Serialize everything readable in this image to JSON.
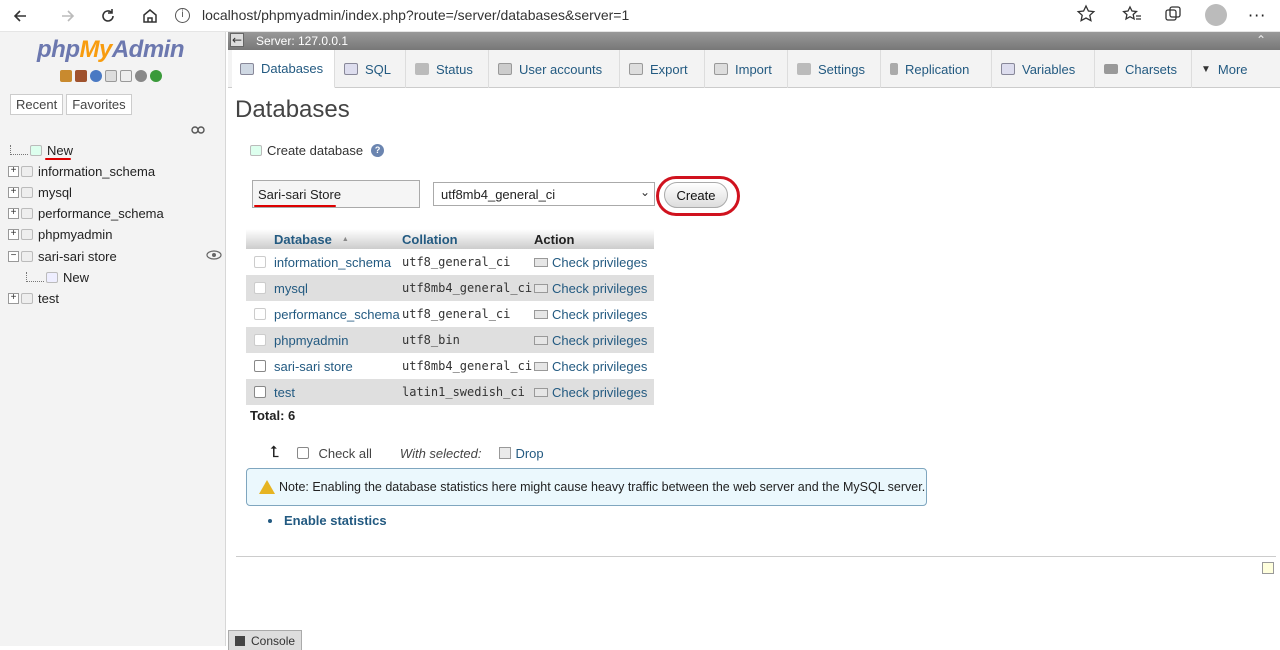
{
  "browser": {
    "url": "localhost/phpmyadmin/index.php?route=/server/databases&server=1"
  },
  "sidebar": {
    "logo": {
      "php": "php",
      "my": "My",
      "admin": "Admin"
    },
    "tabs": [
      "Recent",
      "Favorites"
    ],
    "tree": [
      {
        "label": "New",
        "type": "new"
      },
      {
        "label": "information_schema",
        "type": "db"
      },
      {
        "label": "mysql",
        "type": "db"
      },
      {
        "label": "performance_schema",
        "type": "db"
      },
      {
        "label": "phpmyadmin",
        "type": "db"
      },
      {
        "label": "sari-sari store",
        "type": "db-open"
      },
      {
        "label": "New",
        "type": "new-child"
      },
      {
        "label": "test",
        "type": "db"
      }
    ]
  },
  "server_bar": {
    "label": "Server: 127.0.0.1"
  },
  "menu": [
    {
      "label": "Databases",
      "icon": "database-icon"
    },
    {
      "label": "SQL",
      "icon": "sql-icon"
    },
    {
      "label": "Status",
      "icon": "status-icon"
    },
    {
      "label": "User accounts",
      "icon": "users-icon"
    },
    {
      "label": "Export",
      "icon": "export-icon"
    },
    {
      "label": "Import",
      "icon": "import-icon"
    },
    {
      "label": "Settings",
      "icon": "wrench-icon"
    },
    {
      "label": "Replication",
      "icon": "replication-icon"
    },
    {
      "label": "Variables",
      "icon": "variables-icon"
    },
    {
      "label": "Charsets",
      "icon": "charsets-icon"
    },
    {
      "label": "More",
      "icon": "chevron-down-icon"
    }
  ],
  "page": {
    "title": "Databases",
    "create_label": "Create database",
    "db_name_value": "Sari-sari Store",
    "collation_value": "utf8mb4_general_ci",
    "create_button": "Create"
  },
  "table": {
    "headers": {
      "database": "Database",
      "collation": "Collation",
      "action": "Action"
    },
    "sort_indicator": "▲",
    "rows": [
      {
        "name": "information_schema",
        "collation": "utf8_general_ci",
        "action": "Check privileges"
      },
      {
        "name": "mysql",
        "collation": "utf8mb4_general_ci",
        "action": "Check privileges"
      },
      {
        "name": "performance_schema",
        "collation": "utf8_general_ci",
        "action": "Check privileges"
      },
      {
        "name": "phpmyadmin",
        "collation": "utf8_bin",
        "action": "Check privileges"
      },
      {
        "name": "sari-sari store",
        "collation": "utf8mb4_general_ci",
        "action": "Check privileges"
      },
      {
        "name": "test",
        "collation": "latin1_swedish_ci",
        "action": "Check privileges"
      }
    ],
    "total": "Total: 6"
  },
  "bulk": {
    "check_all": "Check all",
    "with_selected": "With selected:",
    "drop": "Drop"
  },
  "notice": "Note: Enabling the database statistics here might cause heavy traffic between the web server and the MySQL server.",
  "enable_stats": "Enable statistics",
  "console": "Console",
  "colors": {
    "link": "#235a81",
    "highlight": "#d0121e",
    "notice_bg": "#ebf8fd"
  }
}
